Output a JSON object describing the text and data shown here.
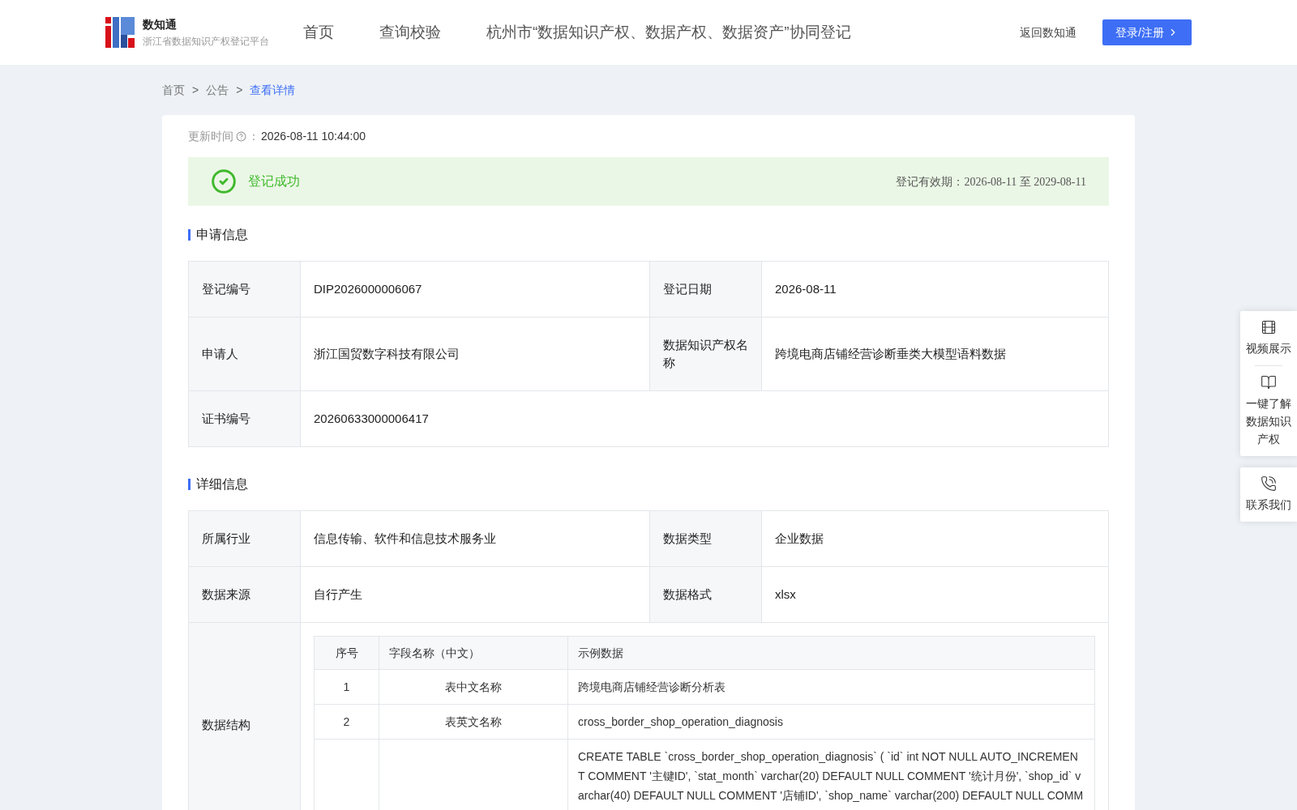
{
  "header": {
    "logo": {
      "name": "数知通",
      "subtitle": "浙江省数据知识产权登记平台"
    },
    "nav": [
      {
        "label": "首页"
      },
      {
        "label": "查询校验"
      },
      {
        "label": "杭州市“数据知识产权、数据产权、数据资产”协同登记"
      }
    ],
    "back_link": "返回数知通",
    "login_button": "登录/注册"
  },
  "breadcrumb": [
    {
      "label": "首页",
      "current": false
    },
    {
      "label": "公告",
      "current": false
    },
    {
      "label": "查看详情",
      "current": true
    }
  ],
  "breadcrumb_separator": ">",
  "update_time": {
    "label": "更新时间",
    "colon": "：",
    "value": "2026-08-11 10:44:00"
  },
  "status": {
    "kind": "success",
    "text": "登记成功",
    "validity": "登记有效期：2026-08-11 至 2029-08-11"
  },
  "apply_section": {
    "title": "申请信息",
    "rows": [
      [
        {
          "label": "登记编号",
          "value": "DIP2026000006067"
        },
        {
          "label": "登记日期",
          "value": "2026-08-11"
        }
      ],
      [
        {
          "label": "申请人",
          "value": "浙江国贸数字科技有限公司"
        },
        {
          "label": "数据知识产权名称",
          "value": "跨境电商店铺经营诊断垂类大模型语料数据"
        }
      ],
      [
        {
          "label": "证书编号",
          "value": "20260633000006417"
        }
      ]
    ]
  },
  "detail_section": {
    "title": "详细信息",
    "rows": [
      [
        {
          "label": "所属行业",
          "value": "信息传输、软件和信息技术服务业"
        },
        {
          "label": "数据类型",
          "value": "企业数据"
        }
      ],
      [
        {
          "label": "数据来源",
          "value": "自行产生"
        },
        {
          "label": "数据格式",
          "value": "xlsx"
        }
      ]
    ],
    "structure": {
      "label": "数据结构",
      "columns": [
        "序号",
        "字段名称（中文）",
        "示例数据"
      ],
      "rows": [
        {
          "index": "1",
          "field": "表中文名称",
          "example": "跨境电商店铺经营诊断分析表"
        },
        {
          "index": "2",
          "field": "表英文名称",
          "example": "cross_border_shop_operation_diagnosis"
        },
        {
          "example": "CREATE TABLE `cross_border_shop_operation_diagnosis` ( `id` int NOT NULL AUTO_INCREMENT COMMENT '主键ID', `stat_month` varchar(20) DEFAULT NULL COMMENT '统计月份', `shop_id` varchar(40) DEFAULT NULL COMMENT '店铺ID', `shop_name` varchar(200) DEFAULT NULL COMM"
        }
      ]
    }
  },
  "side_float": [
    {
      "items": [
        {
          "kind": "video",
          "label": "视频展示"
        },
        {
          "kind": "book",
          "label": "一键了解数据知识产权"
        }
      ]
    },
    {
      "items": [
        {
          "kind": "phone",
          "label": "联系我们"
        }
      ]
    }
  ]
}
